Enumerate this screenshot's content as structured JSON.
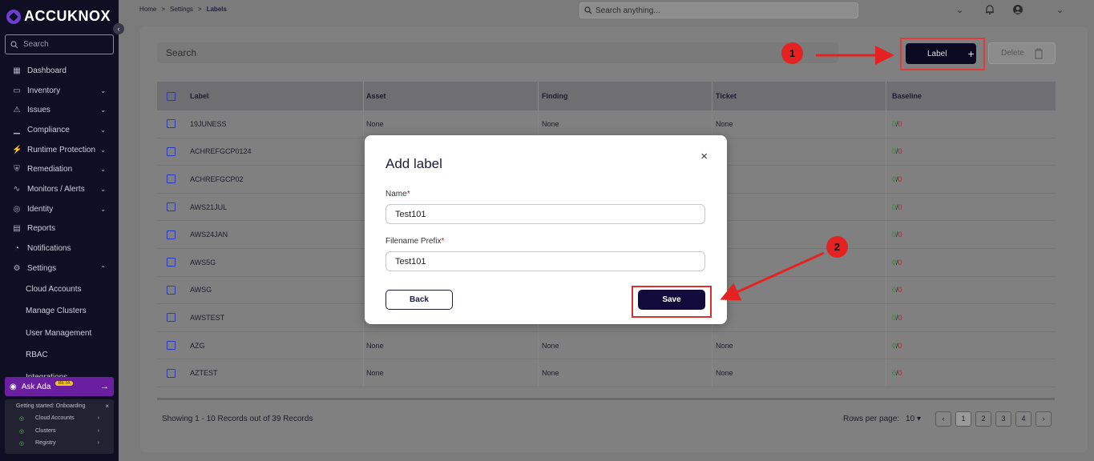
{
  "app": {
    "logo_text": "ACCUKNOX",
    "collapse_icon": "‹"
  },
  "sidebar": {
    "search_placeholder": "Search",
    "items": [
      {
        "label": "Dashboard",
        "icon": "dashboard-icon",
        "glyph": "▦",
        "chevron": ""
      },
      {
        "label": "Inventory",
        "icon": "inventory-icon",
        "glyph": "▭",
        "chevron": "⌄"
      },
      {
        "label": "Issues",
        "icon": "issues-icon",
        "glyph": "⚠",
        "chevron": "⌄"
      },
      {
        "label": "Compliance",
        "icon": "compliance-icon",
        "glyph": "▁",
        "chevron": "⌄"
      },
      {
        "label": "Runtime Protection",
        "icon": "runtime-icon",
        "glyph": "⚡",
        "chevron": "⌄"
      },
      {
        "label": "Remediation",
        "icon": "remediation-icon",
        "glyph": "⛨",
        "chevron": "⌄"
      },
      {
        "label": "Monitors / Alerts",
        "icon": "monitors-icon",
        "glyph": "∿",
        "chevron": "⌄"
      },
      {
        "label": "Identity",
        "icon": "identity-icon",
        "glyph": "◎",
        "chevron": "⌄"
      },
      {
        "label": "Reports",
        "icon": "reports-icon",
        "glyph": "▤",
        "chevron": ""
      },
      {
        "label": "Notifications",
        "icon": "bell-icon",
        "glyph": "◔",
        "chevron": ""
      },
      {
        "label": "Settings",
        "icon": "gear-icon",
        "glyph": "⚙",
        "chevron": "⌃"
      }
    ],
    "sub_items": [
      "Cloud Accounts",
      "Manage Clusters",
      "User Management",
      "RBAC",
      "Integrations"
    ],
    "ask_ada": {
      "label": "Ask Ada",
      "badge": "BETA",
      "arrow": "→"
    },
    "onboarding": {
      "title": "Getting started: Onboarding",
      "close": "×",
      "items": [
        "Cloud Accounts",
        "Clusters",
        "Registry"
      ]
    }
  },
  "topbar": {
    "breadcrumb": [
      "Home",
      ">",
      "Settings",
      ">",
      "Labels"
    ],
    "search_placeholder": "Search anything...",
    "dropdown_icon": "⌄",
    "bell_icon": "🔔",
    "user_icon": "●",
    "user_chevron": "⌄"
  },
  "page": {
    "search_placeholder": "Search",
    "label_button": "Label",
    "label_button_icon": "+",
    "delete_button": "Delete",
    "delete_icon": "🗑"
  },
  "table": {
    "headers": {
      "label": "Label",
      "asset": "Asset",
      "finding": "Finding",
      "ticket": "Ticket",
      "baseline": "Baseline"
    },
    "rows": [
      {
        "label": "19JUNESS",
        "asset": "None",
        "finding": "None",
        "ticket": "None",
        "b_ok": "0",
        "b_bad": "0"
      },
      {
        "label": "ACHREFGCP0124",
        "asset": "",
        "finding": "",
        "ticket": "ne",
        "b_ok": "0",
        "b_bad": "0"
      },
      {
        "label": "ACHREFGCP02",
        "asset": "",
        "finding": "",
        "ticket": "ne",
        "b_ok": "0",
        "b_bad": "0"
      },
      {
        "label": "AWS21JUL",
        "asset": "",
        "finding": "",
        "ticket": "ne",
        "b_ok": "0",
        "b_bad": "0"
      },
      {
        "label": "AWS24JAN",
        "asset": "",
        "finding": "",
        "ticket": "ne",
        "b_ok": "0",
        "b_bad": "0"
      },
      {
        "label": "AWS5G",
        "asset": "",
        "finding": "",
        "ticket": "ne",
        "b_ok": "0",
        "b_bad": "0"
      },
      {
        "label": "AWSG",
        "asset": "",
        "finding": "",
        "ticket": "ne",
        "b_ok": "0",
        "b_bad": "0"
      },
      {
        "label": "AWSTEST",
        "asset": "",
        "finding": "",
        "ticket": "ne",
        "b_ok": "0",
        "b_bad": "0"
      },
      {
        "label": "AZG",
        "asset": "None",
        "finding": "None",
        "ticket": "None",
        "b_ok": "0",
        "b_bad": "0"
      },
      {
        "label": "AZTEST",
        "asset": "None",
        "finding": "None",
        "ticket": "None",
        "b_ok": "0",
        "b_bad": "0"
      }
    ],
    "slash": "/"
  },
  "footer": {
    "records": "Showing 1 - 10 Records out of 39 Records",
    "rows_per_page_label": "Rows per page:",
    "rows_per_page_value": "10",
    "rows_per_page_caret": "▾",
    "prev": "‹",
    "pages": [
      "1",
      "2",
      "3",
      "4"
    ],
    "next": "›"
  },
  "modal": {
    "title": "Add label",
    "close": "×",
    "name_label": "Name",
    "name_value": "Test101",
    "prefix_label": "Filename Prefix",
    "prefix_value": "Test101",
    "required_mark": "*",
    "back_button": "Back",
    "save_button": "Save"
  },
  "annotations": {
    "step1": "1",
    "step2": "2"
  },
  "colors": {
    "sidebar_bg": "#0f0e23",
    "accent": "#120a3a",
    "annotation": "#e52222"
  }
}
